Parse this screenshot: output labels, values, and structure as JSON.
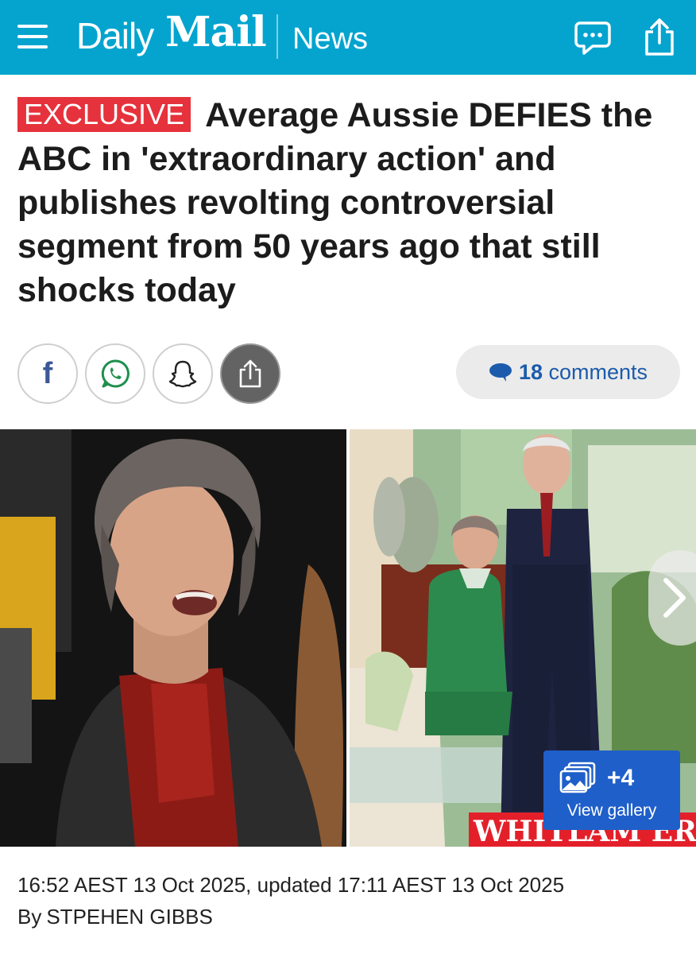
{
  "header": {
    "brand_daily": "Daily",
    "brand_mail": "Mail",
    "section": "News",
    "bg_color": "#04a4cf",
    "icons": [
      "menu-icon",
      "comment-icon",
      "share-icon"
    ]
  },
  "article": {
    "badge": "EXCLUSIVE",
    "badge_color": "#e6323c",
    "headline": "Average Aussie DEFIES the ABC in 'extraordinary action' and publishes revolting controversial segment from 50 years ago that still shocks today"
  },
  "share": {
    "buttons": [
      "facebook-icon",
      "whatsapp-icon",
      "snapchat-icon",
      "share-icon"
    ],
    "facebook_letter": "f",
    "comments_count": "18",
    "comments_label": "comments"
  },
  "gallery": {
    "extra_count": "+4",
    "view_label": "View gallery",
    "banner_text": "WHITLAM ERA",
    "button_color": "#1f5fc9"
  },
  "meta": {
    "timestamp": "16:52 AEST 13 Oct 2025, updated 17:11 AEST 13 Oct 2025",
    "by_prefix": "By",
    "author": "STPEHEN GIBBS"
  }
}
